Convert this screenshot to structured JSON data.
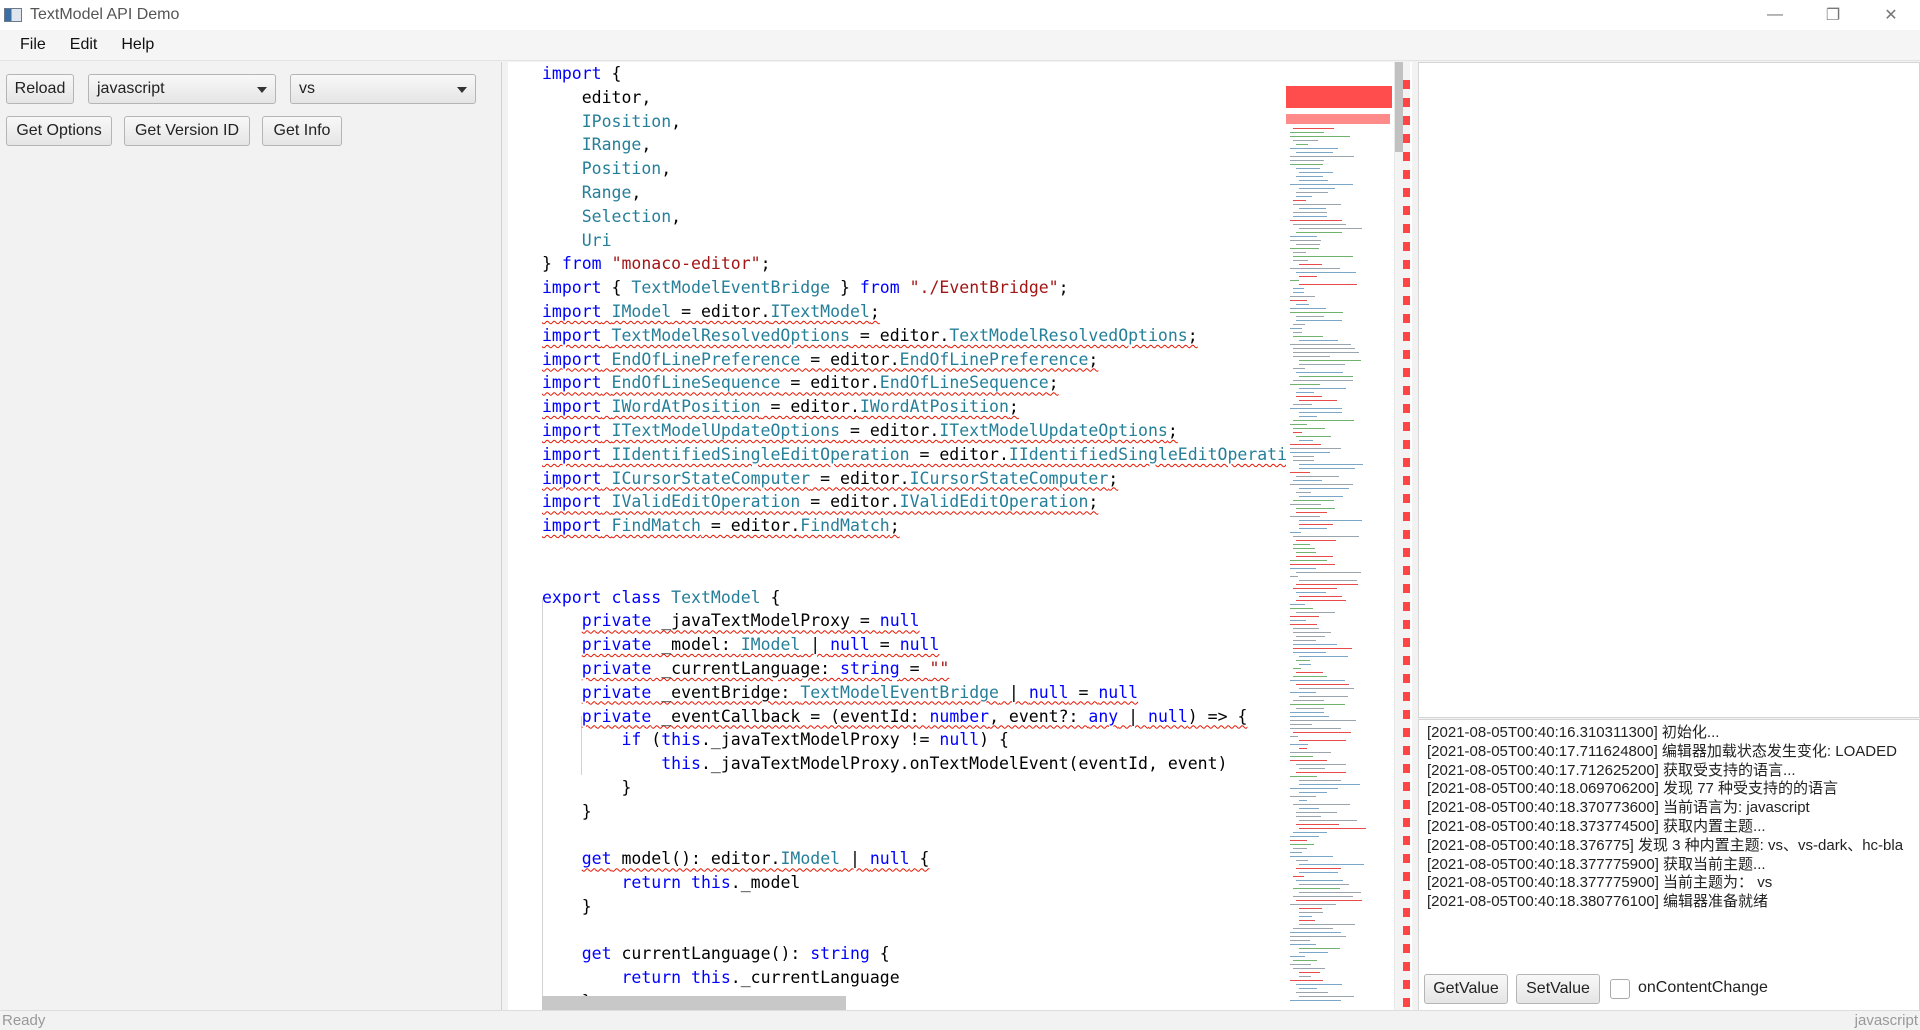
{
  "window": {
    "title": "TextModel API Demo",
    "minimize_glyph": "—",
    "restore_glyph": "❐",
    "close_glyph": "✕"
  },
  "menu": [
    "File",
    "Edit",
    "Help"
  ],
  "toolbar": {
    "reload_label": "Reload",
    "language_value": "javascript",
    "theme_value": "vs",
    "get_options_label": "Get Options",
    "get_version_id_label": "Get Version ID",
    "get_info_label": "Get Info"
  },
  "editor": {
    "lines": [
      "import {",
      "    editor,",
      "    IPosition,",
      "    IRange,",
      "    Position,",
      "    Range,",
      "    Selection,",
      "    Uri",
      "} from \"monaco-editor\";",
      "import { TextModelEventBridge } from \"./EventBridge\";",
      "import IModel = editor.ITextModel;",
      "import TextModelResolvedOptions = editor.TextModelResolvedOptions;",
      "import EndOfLinePreference = editor.EndOfLinePreference;",
      "import EndOfLineSequence = editor.EndOfLineSequence;",
      "import IWordAtPosition = editor.IWordAtPosition;",
      "import ITextModelUpdateOptions = editor.ITextModelUpdateOptions;",
      "import IIdentifiedSingleEditOperation = editor.IIdentifiedSingleEditOperation",
      "import ICursorStateComputer = editor.ICursorStateComputer;",
      "import IValidEditOperation = editor.IValidEditOperation;",
      "import FindMatch = editor.FindMatch;",
      "",
      "",
      "export class TextModel {",
      "    private _javaTextModelProxy = null",
      "    private _model: IModel | null = null",
      "    private _currentLanguage: string = \"\"",
      "    private _eventBridge: TextModelEventBridge | null = null",
      "    private _eventCallback = (eventId: number, event?: any | null) => {",
      "        if (this._javaTextModelProxy != null) {",
      "            this._javaTextModelProxy.onTextModelEvent(eventId, event)",
      "        }",
      "    }",
      "",
      "    get model(): editor.IModel | null {",
      "        return this._model",
      "    }",
      "",
      "    get currentLanguage(): string {",
      "        return this._currentLanguage",
      "    }"
    ]
  },
  "log": {
    "lines": [
      "[2021-08-05T00:40:16.310311300] 初始化...",
      "[2021-08-05T00:40:17.711624800] 编辑器加载状态发生变化: LOADED",
      "[2021-08-05T00:40:17.712625200] 获取受支持的语言...",
      "[2021-08-05T00:40:18.069706200] 发现 77 种受支持的的语言",
      "[2021-08-05T00:40:18.370773600] 当前语言为: javascript",
      "[2021-08-05T00:40:18.373774500] 获取内置主题...",
      "[2021-08-05T00:40:18.376775] 发现 3 种内置主题: vs、vs-dark、hc-bla",
      "[2021-08-05T00:40:18.377775900] 获取当前主题...",
      "[2021-08-05T00:40:18.377775900] 当前主题为： vs",
      "[2021-08-05T00:40:18.380776100] 编辑器准备就绪"
    ],
    "scroll_left_glyph": "‹"
  },
  "bottom_controls": {
    "get_value_label": "GetValue",
    "set_value_label": "SetValue",
    "on_content_change_label": "onContentChange",
    "on_content_change_checked": false
  },
  "status": {
    "left": "Ready",
    "right": "javascript"
  },
  "colors": {
    "keyword": "#0000ff",
    "type": "#267f99",
    "string": "#a31515",
    "error_squiggle": "#e51400"
  }
}
